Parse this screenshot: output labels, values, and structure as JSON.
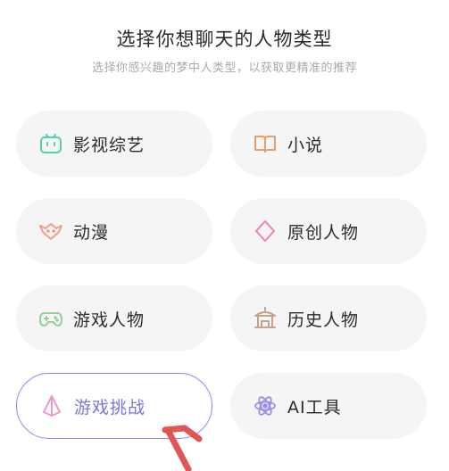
{
  "header": {
    "title": "选择你想聊天的人物类型",
    "subtitle": "选择你感兴趣的梦中人类型，以获取更精准的推荐"
  },
  "categories": [
    {
      "label": "影视综艺",
      "icon": "tv-icon",
      "color": "#57cfa6",
      "selected": false
    },
    {
      "label": "小说",
      "icon": "book-icon",
      "color": "#e0a068",
      "selected": false
    },
    {
      "label": "动漫",
      "icon": "anime-icon",
      "color": "#ee9e8a",
      "selected": false
    },
    {
      "label": "原创人物",
      "icon": "diamond-icon",
      "color": "#ef84aa",
      "selected": false
    },
    {
      "label": "游戏人物",
      "icon": "gamepad-icon",
      "color": "#95cf9f",
      "selected": false
    },
    {
      "label": "历史人物",
      "icon": "pavilion-icon",
      "color": "#c6a18d",
      "selected": false
    },
    {
      "label": "游戏挑战",
      "icon": "pyramid-icon",
      "color": "#e79acb",
      "selected": true
    },
    {
      "label": "AI工具",
      "icon": "atom-icon",
      "color": "#9b8fe4",
      "selected": false
    }
  ],
  "colors": {
    "accent": "#8e86e8",
    "card_bg": "#f5f5f5",
    "annotation_arrow": "#e25555"
  }
}
